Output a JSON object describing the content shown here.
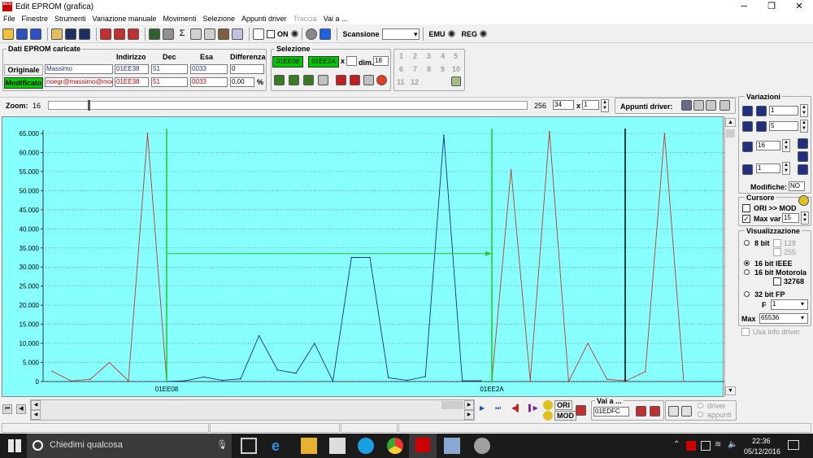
{
  "window": {
    "title": "Edit EPROM (grafica)",
    "app_icon": "ECU"
  },
  "menu": [
    "File",
    "Finestre",
    "Strumenti",
    "Variazione manuale",
    "Movimenti",
    "Selezione",
    "Appunti driver",
    "Traccia",
    "Vai a ..."
  ],
  "toolbar": {
    "on_label": "ON",
    "scansione_label": "Scansione",
    "emu_label": "EMU",
    "reg_label": "REG"
  },
  "eprom": {
    "title": "Dati EPROM caricate",
    "headers": {
      "indirizzo": "Indirizzo",
      "dec": "Dec",
      "esa": "Esa",
      "differenza": "Differenza"
    },
    "originale": {
      "label": "Originale",
      "name": "Massimo",
      "indirizzo": "01EE38",
      "dec": "51",
      "esa": "0033",
      "diff": "0"
    },
    "modificato": {
      "label": "Modificato",
      "name": "noegr@massimo@mod",
      "indirizzo": "01EE38",
      "dec": "51",
      "esa": "0033",
      "diff": "0,00",
      "unit": "%"
    }
  },
  "selezione": {
    "title": "Selezione",
    "from": "01EE08",
    "to": "01EE2A",
    "x": "x",
    "dim_label": "dim.",
    "dim_value": "18"
  },
  "numbers": [
    "1",
    "2",
    "3",
    "4",
    "5",
    "6",
    "7",
    "8",
    "9",
    "10",
    "11",
    "12"
  ],
  "zoom": {
    "label": "Zoom:",
    "value": "16",
    "max": "256",
    "field": "34",
    "x": "x",
    "mult": "1",
    "appunti": "Appunti driver:"
  },
  "chart_data": {
    "type": "line",
    "ylim": [
      0,
      65000
    ],
    "yticks": [
      "0",
      "5.000",
      "10.000",
      "15.000",
      "20.000",
      "25.000",
      "30.000",
      "35.000",
      "40.000",
      "45.000",
      "50.000",
      "55.000",
      "60.000",
      "65.000"
    ],
    "xlabels": [
      "01EE08",
      "01EE2A"
    ],
    "series": [
      {
        "values": [
          2700,
          150,
          600,
          5000,
          200,
          65000,
          0
        ]
      },
      {
        "values": [
          0,
          200,
          1200,
          300,
          700,
          12000,
          3000,
          2200,
          10000,
          100,
          32500,
          32500,
          1000,
          300,
          1300,
          64500,
          200,
          200
        ]
      },
      {
        "values": [
          200,
          55500,
          200,
          65500,
          0,
          10000,
          600,
          200,
          2600,
          65000,
          0
        ]
      }
    ],
    "arrow_level": 33500
  },
  "variazioni": {
    "title": "Variazioni",
    "f1": "1",
    "f2": "5",
    "f3": "16",
    "f4": "1",
    "modifiche_label": "Modifiche:",
    "modifiche": "NO"
  },
  "cursore": {
    "title": "Cursore",
    "ori_mod": "ORI >> MOD",
    "max_var": "Max var",
    "max_var_val": "15"
  },
  "visualizzazione": {
    "title": "Visualizzazione",
    "opt8": "8 bit",
    "c128": "128",
    "c255": "255",
    "opt16ieee": "16 bit IEEE",
    "opt16m": "16 bit Motorola",
    "c32768": "32768",
    "opt32": "32 bit FP",
    "f_label": "F",
    "f_val": "1",
    "max_label": "Max",
    "max_val": "65536",
    "usa": "Usa info driver"
  },
  "bottom": {
    "ori": "ORI",
    "mod": "MOD",
    "vai_label": "Vai a ...",
    "vai_val": "01EDFC",
    "driver": "driver",
    "appunti": "appunti"
  },
  "taskbar": {
    "search": "Chiedimi qualcosa",
    "time": "22:36",
    "date": "05/12/2016"
  }
}
